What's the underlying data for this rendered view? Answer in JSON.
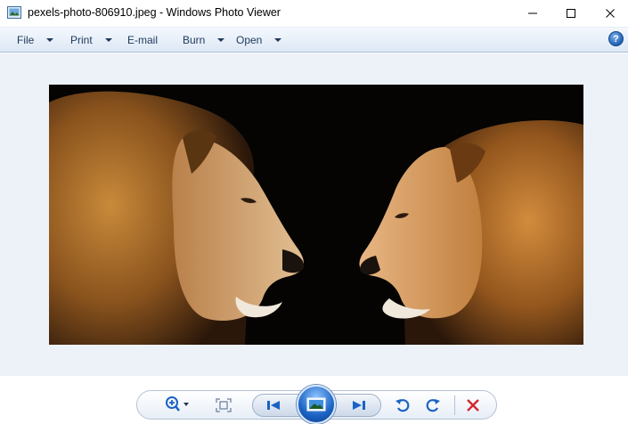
{
  "window": {
    "title": "pexels-photo-806910.jpeg - Windows Photo Viewer"
  },
  "menu": {
    "items": [
      {
        "label": "File",
        "has_dropdown": true
      },
      {
        "label": "Print",
        "has_dropdown": true
      },
      {
        "label": "E-mail",
        "has_dropdown": false
      },
      {
        "label": "Burn",
        "has_dropdown": true
      },
      {
        "label": "Open",
        "has_dropdown": true
      }
    ],
    "help_label": "?"
  },
  "controls": {
    "icons": [
      "zoom-icon",
      "actual-size-icon",
      "previous-icon",
      "play-slideshow-icon",
      "next-icon",
      "rotate-counterclockwise-icon",
      "rotate-clockwise-icon",
      "delete-icon"
    ]
  },
  "colors": {
    "accent": "#1a62c4",
    "menu_text": "#1e395b",
    "delete": "#d3262b",
    "viewer_background": "#edf2f9"
  }
}
